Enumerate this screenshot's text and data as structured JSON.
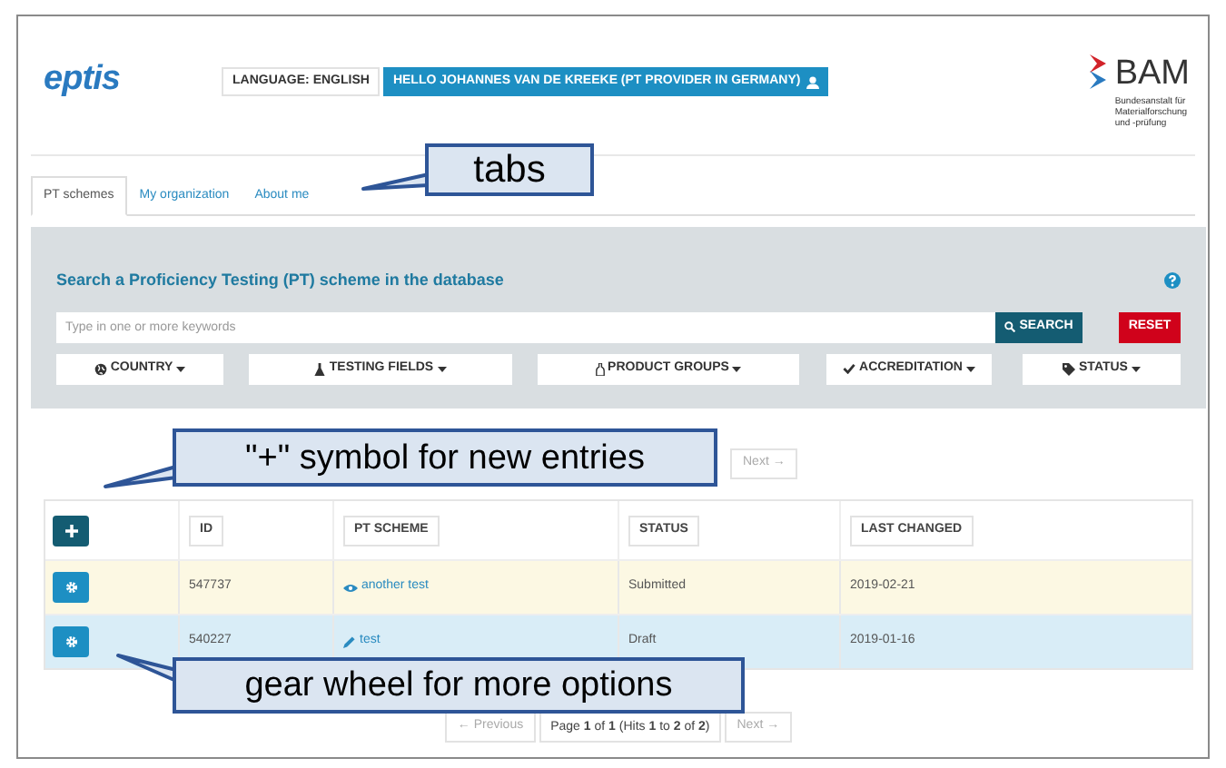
{
  "header": {
    "logo": "eptis",
    "language_button": "LANGUAGE: ENGLISH",
    "user_button": "HELLO JOHANNES VAN DE KREEKE (PT PROVIDER IN GERMANY)",
    "org_logo": {
      "name": "BAM",
      "subtitle": [
        "Bundesanstalt für",
        "Materialforschung",
        "und -prüfung"
      ]
    }
  },
  "tabs": [
    {
      "label": "PT schemes",
      "selected": true
    },
    {
      "label": "My organization",
      "selected": false
    },
    {
      "label": "About me",
      "selected": false
    }
  ],
  "search": {
    "title": "Search a Proficiency Testing (PT) scheme in the database",
    "placeholder": "Type in one or more keywords",
    "search_button": "SEARCH",
    "reset_button": "RESET",
    "filters": [
      "COUNTRY",
      "TESTING FIELDS",
      "PRODUCT GROUPS",
      "ACCREDITATION",
      "STATUS"
    ]
  },
  "pagination_top": {
    "next": "Next →"
  },
  "table": {
    "columns": [
      "ID",
      "PT SCHEME",
      "STATUS",
      "LAST CHANGED"
    ],
    "rows": [
      {
        "id": "547737",
        "scheme": "another test",
        "kind": "view",
        "status": "Submitted",
        "last_changed": "2019-02-21",
        "color": "#fcf8e3"
      },
      {
        "id": "540227",
        "scheme": "test",
        "kind": "edit",
        "status": "Draft",
        "last_changed": "2019-01-16",
        "color": "#d9edf7"
      }
    ]
  },
  "pagination_bottom": {
    "previous": "← Previous",
    "page": "Page **1** of **1** (Hits **1** to **2** of **2**)",
    "next": "Next →"
  },
  "callouts": [
    {
      "text": "tabs"
    },
    {
      "text": "\"+\" symbol for new entries"
    },
    {
      "text": "gear wheel for more options"
    }
  ]
}
